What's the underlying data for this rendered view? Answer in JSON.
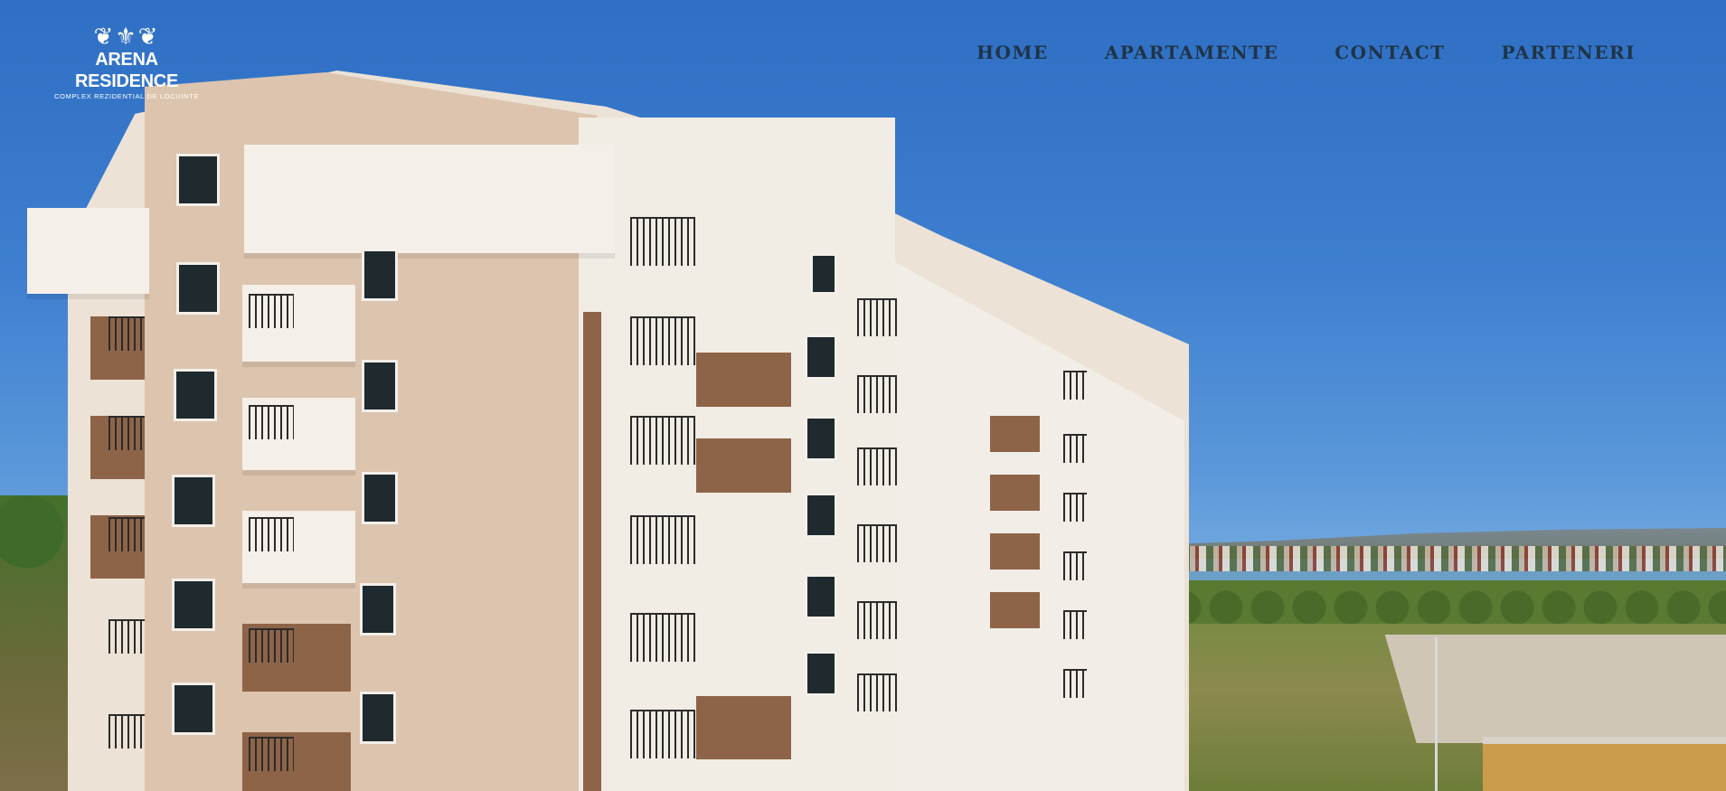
{
  "logo": {
    "name": "ARENA RESIDENCE",
    "tagline": "COMPLEX REZIDENTIAL DE LOCUINTE"
  },
  "nav": {
    "items": [
      {
        "label": "HOME"
      },
      {
        "label": "APARTAMENTE"
      },
      {
        "label": "CONTACT"
      },
      {
        "label": "PARTENERI"
      }
    ]
  },
  "colors": {
    "sky": "#3e7fd0",
    "nav_text": "#1f3447",
    "facade_brown": "#8e6448",
    "facade_cream": "#ece2d6"
  }
}
